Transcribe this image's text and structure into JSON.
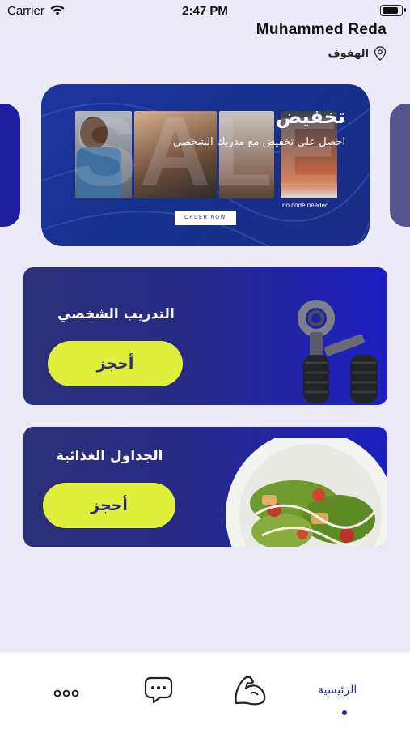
{
  "status_bar": {
    "carrier": "Carrier",
    "time": "2:47 PM",
    "battery_level": 0.9
  },
  "header": {
    "user_name": "Muhammed Reda",
    "location": "الهفوف",
    "location_icon": "map-pin-icon"
  },
  "banner": {
    "title": "تخفيض",
    "subtitle": "احصل على تخفيض مع مدربك الشخصي",
    "big_word": "SALE",
    "order_button": "ORDER NOW",
    "code_note": "no code needed"
  },
  "services": [
    {
      "title": "التدريب الشخصي",
      "button": "أحجز",
      "image": "hand-gripper"
    },
    {
      "title": "الجداول الغذائية",
      "button": "أحجز",
      "image": "salad-plate"
    }
  ],
  "tab_bar": {
    "items": [
      {
        "id": "more",
        "icon": "more-dots-icon"
      },
      {
        "id": "chat",
        "icon": "chat-bubble-icon"
      },
      {
        "id": "workout",
        "icon": "flexed-arm-icon"
      },
      {
        "id": "home",
        "label": "الرئيسية",
        "active": true
      }
    ]
  },
  "colors": {
    "accent_button": "#dff03c",
    "card_gradient_start": "#2d2f78",
    "card_gradient_end": "#1d1fc2",
    "active_tab": "#2c2fa8"
  }
}
